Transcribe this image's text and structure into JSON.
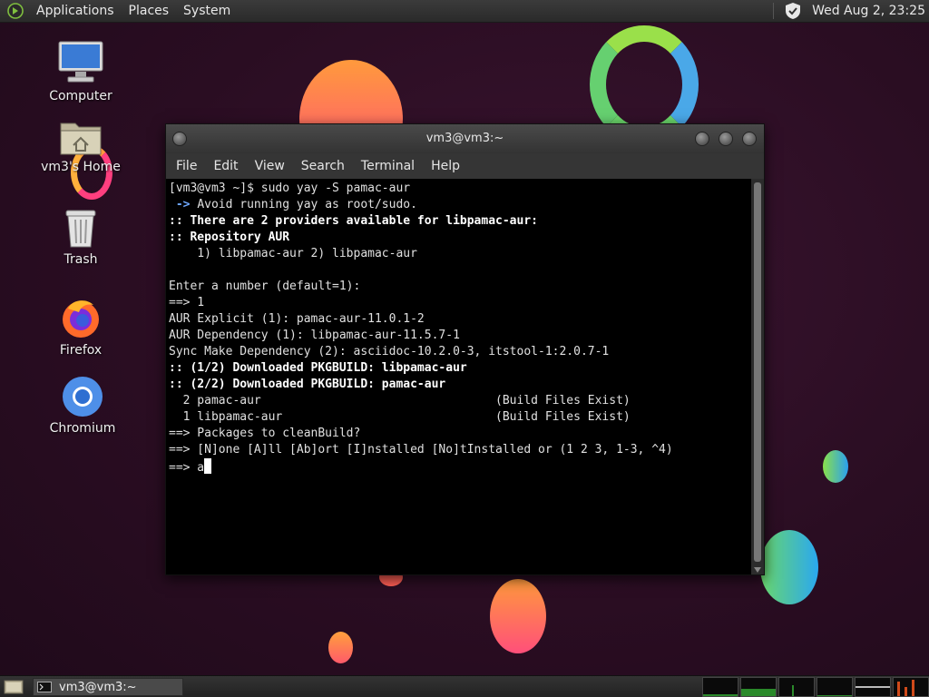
{
  "top_panel": {
    "menus": [
      "Applications",
      "Places",
      "System"
    ],
    "clock": "Wed Aug  2, 23:25",
    "icons": [
      "distro-icon",
      "shield-icon"
    ]
  },
  "desktop": {
    "icons": [
      {
        "label": "Computer",
        "icon": "monitor-icon"
      },
      {
        "label": "vm3's Home",
        "icon": "home-folder-icon"
      },
      {
        "label": "Trash",
        "icon": "trash-icon"
      },
      {
        "label": "Firefox",
        "icon": "firefox-icon"
      },
      {
        "label": "Chromium",
        "icon": "chromium-icon"
      }
    ]
  },
  "window": {
    "title": "vm3@vm3:~",
    "menu": [
      "File",
      "Edit",
      "View",
      "Search",
      "Terminal",
      "Help"
    ]
  },
  "terminal": {
    "lines": [
      {
        "text": "[vm3@vm3 ~]$ sudo yay -S pamac-aur",
        "style": "normal"
      },
      {
        "prefix": " -> ",
        "text": "Avoid running yay as root/sudo.",
        "style": "arrow"
      },
      {
        "text": ":: There are 2 providers available for libpamac-aur:",
        "style": "bold"
      },
      {
        "text": ":: Repository AUR",
        "style": "bold"
      },
      {
        "text": "    1) libpamac-aur 2) libpamac-aur",
        "style": "normal"
      },
      {
        "text": "",
        "style": "normal"
      },
      {
        "text": "Enter a number (default=1):",
        "style": "normal"
      },
      {
        "text": "==> 1",
        "style": "normal"
      },
      {
        "text": "AUR Explicit (1): pamac-aur-11.0.1-2",
        "style": "normal"
      },
      {
        "text": "AUR Dependency (1): libpamac-aur-11.5.7-1",
        "style": "normal"
      },
      {
        "text": "Sync Make Dependency (2): asciidoc-10.2.0-3, itstool-1:2.0.7-1",
        "style": "normal"
      },
      {
        "text": ":: (1/2) Downloaded PKGBUILD: libpamac-aur",
        "style": "bold"
      },
      {
        "text": ":: (2/2) Downloaded PKGBUILD: pamac-aur",
        "style": "bold"
      },
      {
        "text": "  2 pamac-aur                                 (Build Files Exist)",
        "style": "normal"
      },
      {
        "text": "  1 libpamac-aur                              (Build Files Exist)",
        "style": "normal"
      },
      {
        "text": "==> Packages to cleanBuild?",
        "style": "normal"
      },
      {
        "text": "==> [N]one [A]ll [Ab]ort [I]nstalled [No]tInstalled or (1 2 3, 1-3, ^4)",
        "style": "normal"
      }
    ],
    "prompt_line": "==> a"
  },
  "taskbar": {
    "task_label": "vm3@vm3:~"
  }
}
